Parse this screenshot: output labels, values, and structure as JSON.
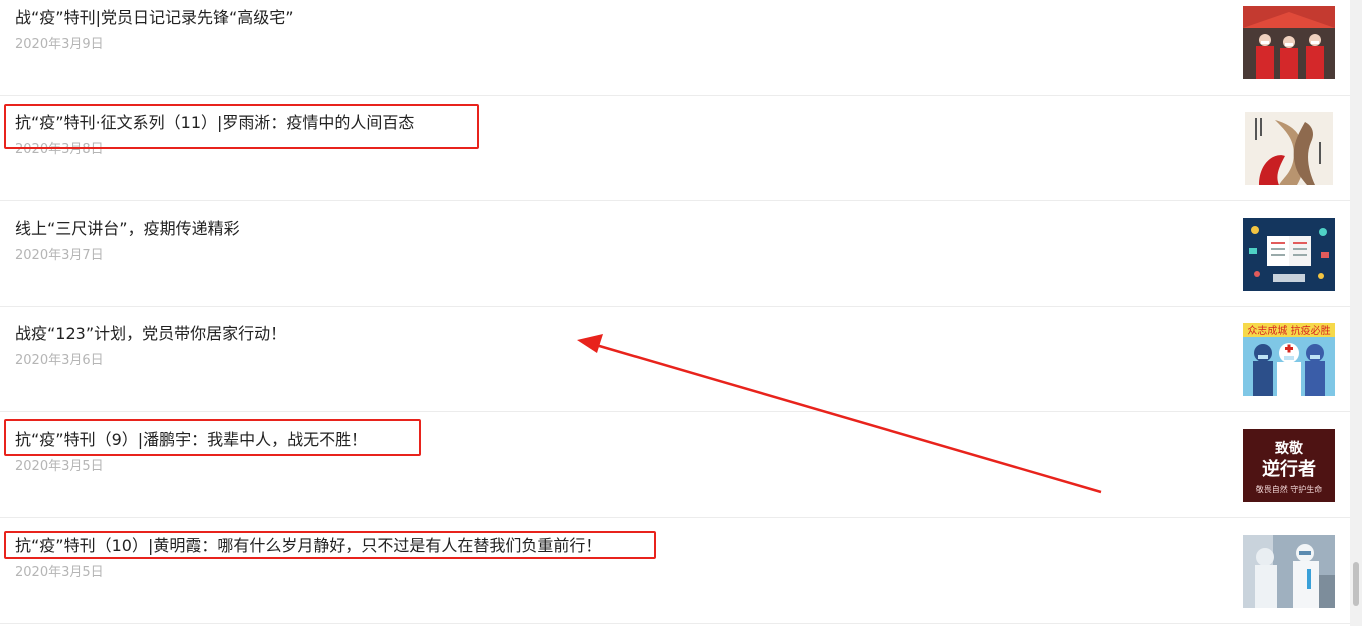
{
  "articles": [
    {
      "title": "战“疫”特刊|党员日记记录先锋“高级宅”",
      "date": "2020年3月9日",
      "thumb": "volunteers-photo"
    },
    {
      "title": "抗“疫”特刊·征文系列（11）|罗雨淅：疫情中的人间百态",
      "date": "2020年3月8日",
      "thumb": "holding-hands-illustration"
    },
    {
      "title": "线上“三尺讲台”，疫期传递精彩",
      "date": "2020年3月7日",
      "thumb": "online-classroom-illustration"
    },
    {
      "title": "战疫“123”计划，党员带你居家行动！",
      "date": "2020年3月6日",
      "thumb": "medical-workers-cartoon"
    },
    {
      "title": "抗“疫”特刊（9）|潘鹏宇：我辈中人，战无不胜！",
      "date": "2020年3月5日",
      "thumb": "tribute-poster"
    },
    {
      "title": "抗“疫”特刊（10）|黄明霞：哪有什么岁月静好，只不过是有人在替我们负重前行！",
      "date": "2020年3月5日",
      "thumb": "protective-suit-photo"
    }
  ],
  "thumb_texts": {
    "poster_line1": "致敬",
    "poster_line2": "逆行者",
    "poster_line3": "敬畏自然 守护生命",
    "cartoon_banner": "众志成城 抗疫必胜"
  },
  "colors": {
    "highlight": "#e8231c",
    "title": "#222222",
    "date": "#b5b5b5"
  }
}
